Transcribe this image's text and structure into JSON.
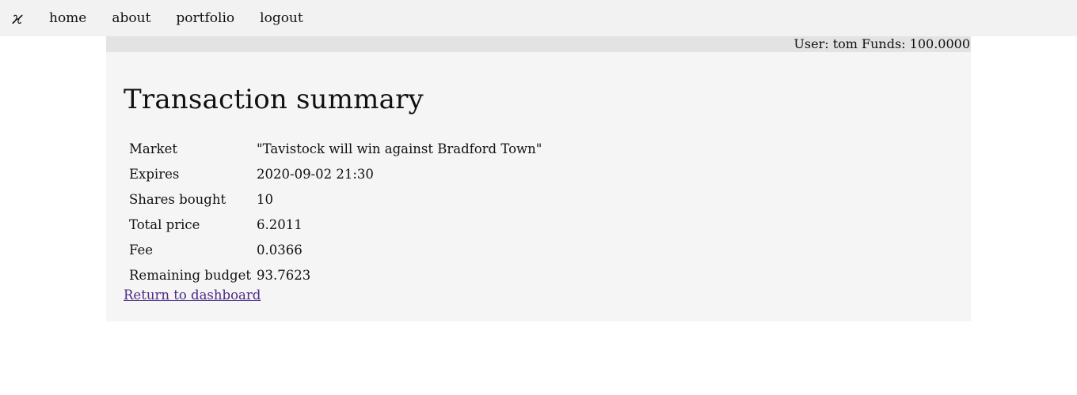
{
  "nav": {
    "logo": "ϰ",
    "links": [
      {
        "label": "home"
      },
      {
        "label": "about"
      },
      {
        "label": "portfolio"
      },
      {
        "label": "logout"
      }
    ]
  },
  "userbar": {
    "text": "User: tom Funds: 100.0000"
  },
  "main": {
    "title": "Transaction summary",
    "rows": [
      {
        "label": "Market",
        "value": "\"Tavistock will win against Bradford Town\""
      },
      {
        "label": "Expires",
        "value": "2020-09-02 21:30"
      },
      {
        "label": "Shares bought",
        "value": "10"
      },
      {
        "label": "Total price",
        "value": "6.2011"
      },
      {
        "label": "Fee",
        "value": "0.0366"
      },
      {
        "label": "Remaining budget",
        "value": "93.7623"
      }
    ],
    "return_link": "Return to dashboard"
  },
  "colors": {
    "navbar_bg": "#f2f2f2",
    "userbar_bg": "#e3e3e3",
    "content_bg": "#f5f5f5",
    "link_visited": "#4b2a86"
  }
}
